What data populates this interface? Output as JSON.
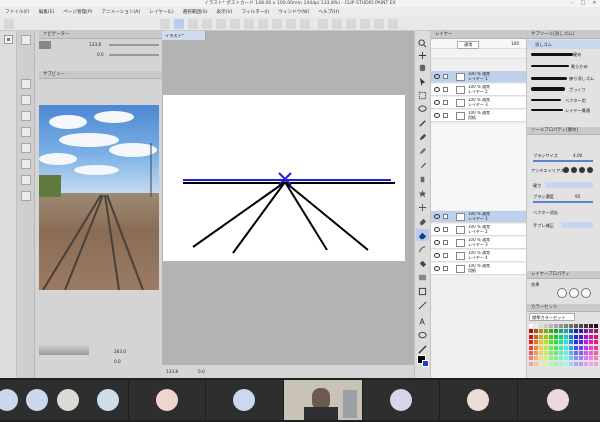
{
  "title": "イラスト* ポストカード 148.00 x 100.00mm 144dpi 133.8%) - CLIP STUDIO PAINT EX",
  "menu": [
    "ファイル(F)",
    "編集(E)",
    "ページ管理(P)",
    "アニメーション(A)",
    "レイヤー(L)",
    "選択範囲(S)",
    "表示(V)",
    "フィルター(I)",
    "ウィンドウ(W)",
    "ヘルプ(H)"
  ],
  "nav_panel": {
    "tab_label": "ナビゲーター",
    "zoom_value": "133.8",
    "angle_value": "0.0",
    "sub_tab": "サブビュー",
    "bottom_zoom": "263.0",
    "bottom_angle": "0.0"
  },
  "canvas_tab": "イラスト*",
  "status": {
    "zoom": "133.8",
    "coords": "0.0"
  },
  "layer_panel": {
    "tab_label": "レイヤー",
    "blend_mode": "通常",
    "opacity": "100",
    "layers": [
      {
        "name": "100 % 通常\nレイヤー 1",
        "selected": true
      },
      {
        "name": "100 % 通常\nレイヤー 2",
        "selected": false
      },
      {
        "name": "100 % 通常\nレイヤー 3",
        "selected": false
      },
      {
        "name": "100 % 通常\n用紙",
        "selected": false
      },
      {
        "name": "100 % 通常\nレイヤー 1",
        "selected": true
      },
      {
        "name": "100 % 通常\nレイヤー 2",
        "selected": false
      },
      {
        "name": "100 % 通常\nレイヤー 3",
        "selected": false
      },
      {
        "name": "100 % 通常\nレイヤー 4",
        "selected": false
      },
      {
        "name": "100 % 通常\n用紙",
        "selected": false
      }
    ]
  },
  "sub_tool": {
    "tab_label": "サブツール[消しゴム]",
    "items": [
      "消しゴム",
      "硬め",
      "軟らかめ",
      "練り消しゴム",
      "ざっくり",
      "ベクター用",
      "レイヤー貫通"
    ],
    "brush_size_label": "ブラシサイズ",
    "brush_size_value": "4.00",
    "antialias_label": "アンチエイリアス",
    "hardness_label": "硬さ",
    "density_label": "ブラシ濃度",
    "density_value": "95",
    "vector_label": "ベクター消去",
    "stabilize_label": "手ブレ補正",
    "prop_tab": "ツールプロパティ[硬め]"
  },
  "layer_property": {
    "tab_label": "レイヤープロパティ",
    "effect_label": "効果"
  },
  "color_set": {
    "tab_label": "カラーセット",
    "set_name": "標準カラーセット"
  },
  "colors": {
    "accent": "#2f62c9",
    "selected_layer": "#bed0ec",
    "line_blue": "#2020d6",
    "line_black": "#000000"
  },
  "meeting_tiles": [
    {
      "color": "#cdd7ea"
    },
    {
      "color": "#d8ddd5"
    },
    {
      "color": "#cfdce6"
    },
    {
      "color": "#f0d4d0"
    },
    {
      "color": "#cdd8ec"
    },
    {
      "color": "#000000"
    },
    {
      "color": "#d7d5ec"
    },
    {
      "color": "#ecddd8"
    },
    {
      "color": "#f0d6e0"
    }
  ]
}
